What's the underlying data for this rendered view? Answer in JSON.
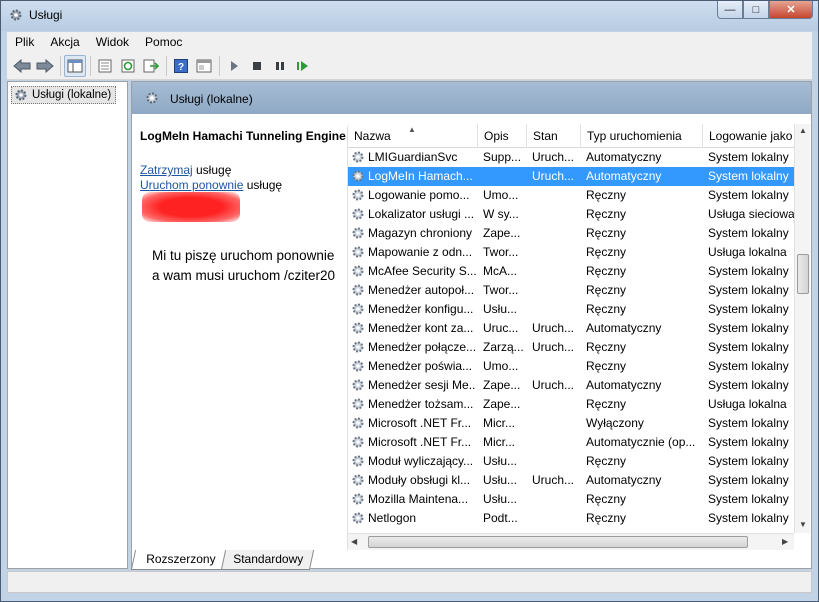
{
  "window": {
    "title": "Usługi"
  },
  "menu": [
    "Plik",
    "Akcja",
    "Widok",
    "Pomoc"
  ],
  "toolbar": {
    "buttons": [
      "back-icon",
      "forward-icon",
      "show-hide-tree-icon",
      "properties-icon",
      "refresh-icon",
      "export-icon",
      "help-icon",
      "console-view-icon",
      "start-service-icon",
      "stop-service-icon",
      "pause-service-icon",
      "restart-service-icon"
    ]
  },
  "tree": {
    "root_label": "Usługi (lokalne)"
  },
  "header": {
    "title": "Usługi (lokalne)"
  },
  "details": {
    "service_name": "LogMeIn Hamachi Tunneling Engine",
    "stop_link": "Zatrzymaj",
    "stop_suffix": " usługę",
    "restart_link": "Uruchom ponownie",
    "restart_suffix": " usługę",
    "note_line1": "Mi tu piszę uruchom ponownie",
    "note_line2": "a wam musi uruchom /cziter20"
  },
  "columns": [
    "Nazwa",
    "Opis",
    "Stan",
    "Typ uruchomienia",
    "Logowanie jako"
  ],
  "services": [
    [
      "LMIGuardianSvc",
      "Supp...",
      "Uruch...",
      "Automatyczny",
      "System lokalny"
    ],
    [
      "LogMeIn Hamach...",
      "",
      "Uruch...",
      "Automatyczny",
      "System lokalny"
    ],
    [
      "Logowanie pomo...",
      "Umo...",
      "",
      "Ręczny",
      "System lokalny"
    ],
    [
      "Lokalizator usługi ...",
      "W sy...",
      "",
      "Ręczny",
      "Usługa sieciowa"
    ],
    [
      "Magazyn chroniony",
      "Zape...",
      "",
      "Ręczny",
      "System lokalny"
    ],
    [
      "Mapowanie z odn...",
      "Twor...",
      "",
      "Ręczny",
      "Usługa lokalna"
    ],
    [
      "McAfee Security S...",
      "McA...",
      "",
      "Ręczny",
      "System lokalny"
    ],
    [
      "Menedżer autopoł...",
      "Twor...",
      "",
      "Ręczny",
      "System lokalny"
    ],
    [
      "Menedżer konfigu...",
      "Usłu...",
      "",
      "Ręczny",
      "System lokalny"
    ],
    [
      "Menedżer kont za...",
      "Uruc...",
      "Uruch...",
      "Automatyczny",
      "System lokalny"
    ],
    [
      "Menedżer połącze...",
      "Zarzą...",
      "Uruch...",
      "Ręczny",
      "System lokalny"
    ],
    [
      "Menedżer poświa...",
      "Umo...",
      "",
      "Ręczny",
      "System lokalny"
    ],
    [
      "Menedżer sesji Me...",
      "Zape...",
      "Uruch...",
      "Automatyczny",
      "System lokalny"
    ],
    [
      "Menedżer tożsam...",
      "Zape...",
      "",
      "Ręczny",
      "Usługa lokalna"
    ],
    [
      "Microsoft .NET Fr...",
      "Micr...",
      "",
      "Wyłączony",
      "System lokalny"
    ],
    [
      "Microsoft .NET Fr...",
      "Micr...",
      "",
      "Automatycznie (op...",
      "System lokalny"
    ],
    [
      "Moduł wyliczający...",
      "Usłu...",
      "",
      "Ręczny",
      "System lokalny"
    ],
    [
      "Moduły obsługi kl...",
      "Usłu...",
      "Uruch...",
      "Automatyczny",
      "System lokalny"
    ],
    [
      "Mozilla Maintena...",
      "Usłu...",
      "",
      "Ręczny",
      "System lokalny"
    ],
    [
      "Netlogon",
      "Podt...",
      "",
      "Ręczny",
      "System lokalny"
    ]
  ],
  "selected_row": 1,
  "tabs": [
    "Rozszerzony",
    "Standardowy"
  ],
  "colors": {
    "selection": "#3399ff",
    "link": "#1e56a3",
    "header_band": "#9bb3cf"
  }
}
